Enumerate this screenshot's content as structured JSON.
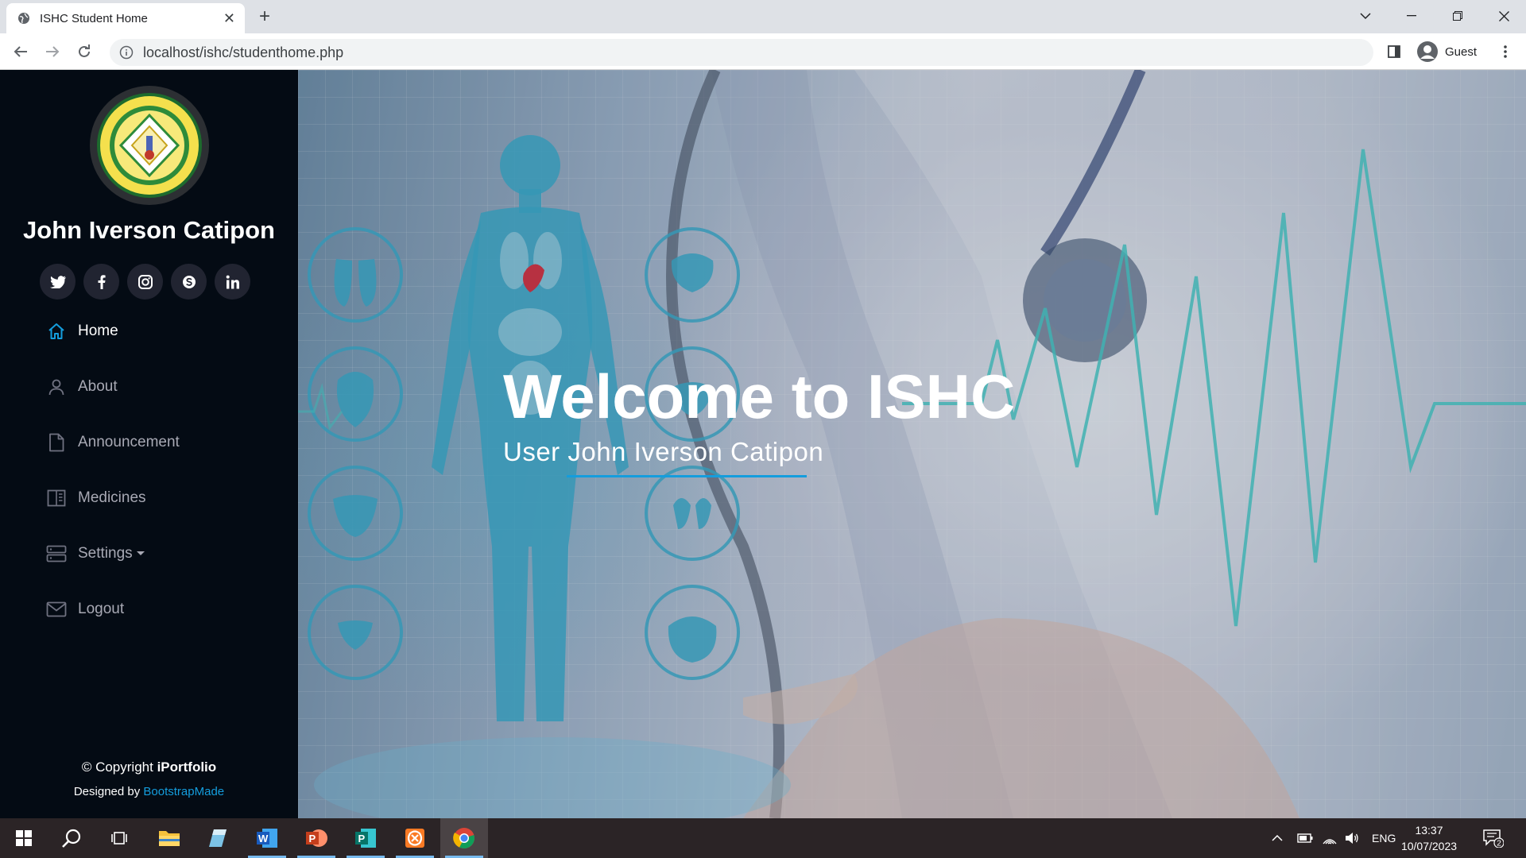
{
  "browser": {
    "tab_title": "ISHC Student Home",
    "url": "localhost/ishc/studenthome.php",
    "profile_label": "Guest"
  },
  "sidebar": {
    "profile_name": "John Iverson Catipon",
    "socials": [
      "twitter-icon",
      "facebook-icon",
      "instagram-icon",
      "skype-icon",
      "linkedin-icon"
    ],
    "nav": [
      {
        "label": "Home",
        "icon": "home-icon",
        "active": true
      },
      {
        "label": "About",
        "icon": "person-icon"
      },
      {
        "label": "Announcement",
        "icon": "file-icon"
      },
      {
        "label": "Medicines",
        "icon": "book-icon"
      },
      {
        "label": "Settings",
        "icon": "server-icon",
        "dropdown": true
      },
      {
        "label": "Logout",
        "icon": "envelope-icon"
      }
    ],
    "footer": {
      "copyright_prefix": "© Copyright ",
      "brand": "iPortfolio",
      "designed_prefix": "Designed by ",
      "designer": "BootstrapMade"
    }
  },
  "hero": {
    "title": "Welcome to ISHC",
    "subtitle": "User John Iverson Catipon"
  },
  "taskbar": {
    "time": "13:37",
    "date": "10/07/2023",
    "language": "ENG",
    "notification_count": "2"
  },
  "colors": {
    "sidebar_bg": "#040b14",
    "accent": "#149ddd",
    "nav_text": "#a8a9b4"
  }
}
